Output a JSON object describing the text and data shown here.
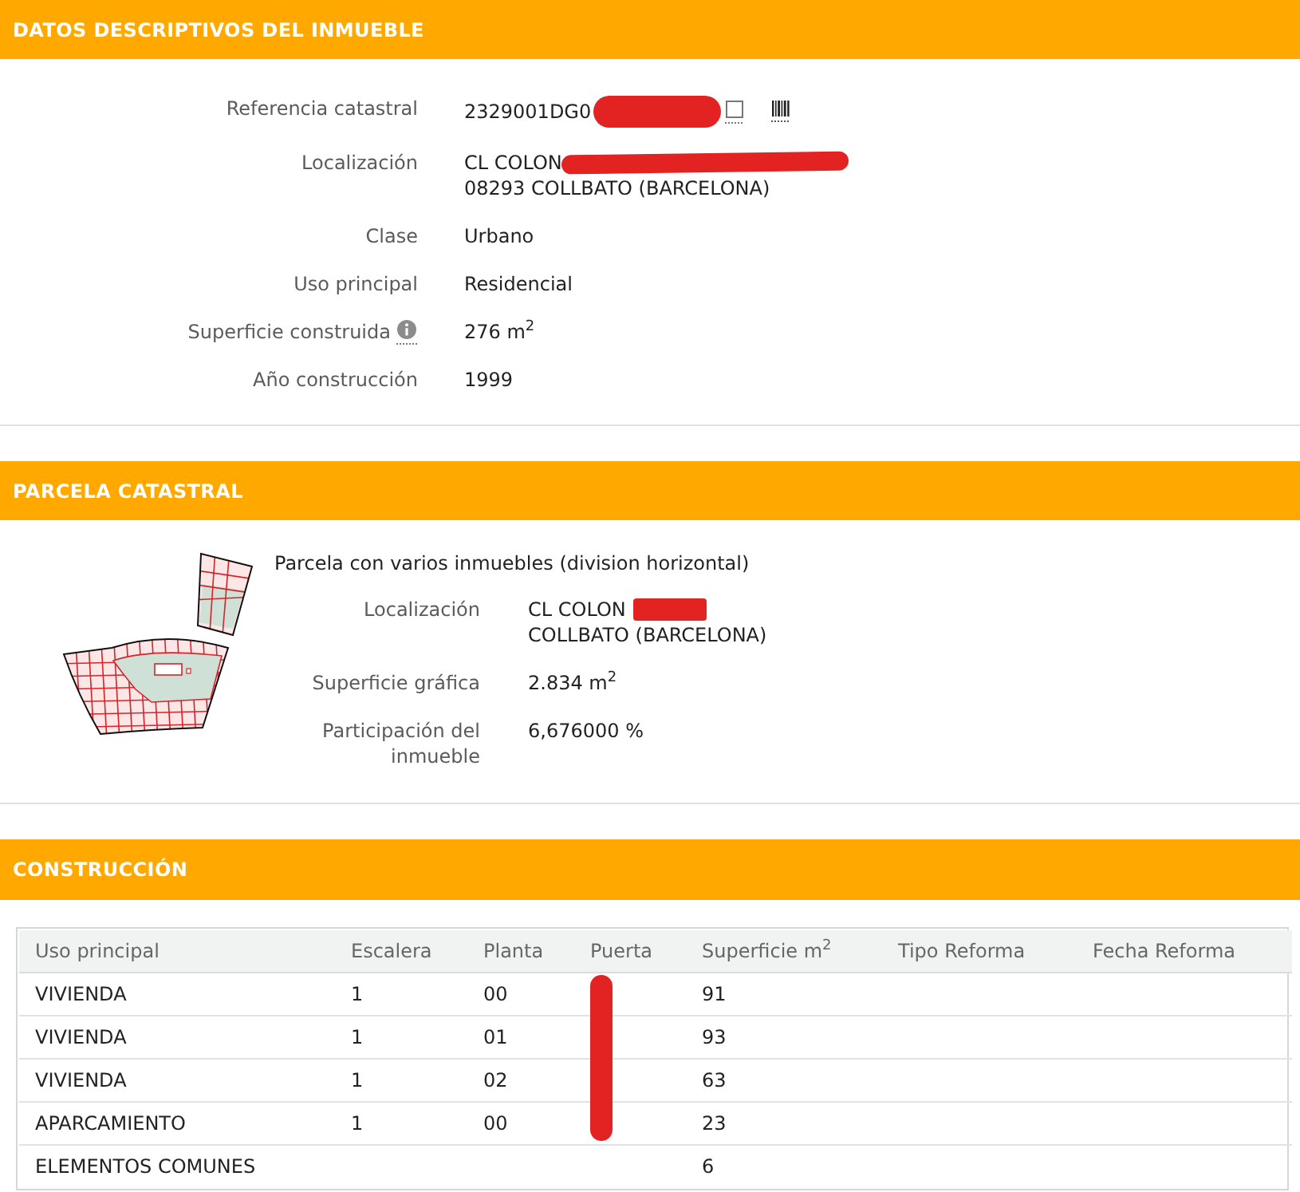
{
  "descriptive_data": {
    "title": "DATOS DESCRIPTIVOS DEL INMUEBLE",
    "fields": [
      {
        "kind": "reference",
        "label": "Referencia catastral",
        "lines": [
          "2329001DG0"
        ],
        "redacted": true
      },
      {
        "kind": "plain",
        "label": "Localización",
        "lines": [
          "CL COLON",
          "08293 COLLBATO (BARCELONA)"
        ],
        "redacted": true
      },
      {
        "kind": "plain",
        "label": "Clase",
        "lines": [
          "Urbano"
        ],
        "redacted": false
      },
      {
        "kind": "plain",
        "label": "Uso principal",
        "lines": [
          "Residencial"
        ],
        "redacted": false
      },
      {
        "kind": "info",
        "label": "Superficie construida",
        "lines": [
          "276 m$^{2}$"
        ],
        "redacted": false
      },
      {
        "kind": "plain",
        "label": "Año construcción",
        "lines": [
          "1999"
        ],
        "redacted": false
      }
    ]
  },
  "cadastral_parcel": {
    "title": "PARCELA CATASTRAL",
    "description": "Parcela con varios inmuebles (division horizontal)",
    "fields": [
      {
        "label": "Localización",
        "lines": [
          "CL COLON",
          "COLLBATO (BARCELONA)"
        ],
        "redacted": true
      },
      {
        "label": "Superficie gráfica",
        "lines": [
          "2.834 m$^{2}$"
        ],
        "redacted": false
      },
      {
        "label": "Participación del inmueble",
        "lines": [
          "6,676000 %"
        ],
        "redacted": false
      }
    ]
  },
  "construction": {
    "title": "CONSTRUCCIÓN",
    "table": {
      "columns": [
        "Uso principal",
        "Escalera",
        "Planta",
        "Puerta",
        "Superficie m$^{2}$",
        "Tipo Reforma",
        "Fecha Reforma"
      ],
      "rows": [
        {
          "uso_principal": "VIVIENDA",
          "escalera": "1",
          "planta": "00",
          "puerta_redacted": true,
          "superficie": "91"
        },
        {
          "uso_principal": "VIVIENDA",
          "escalera": "1",
          "planta": "01",
          "puerta_redacted": true,
          "superficie": "93"
        },
        {
          "uso_principal": "VIVIENDA",
          "escalera": "1",
          "planta": "02",
          "puerta_redacted": true,
          "superficie": "63"
        },
        {
          "uso_principal": "APARCAMIENTO",
          "escalera": "1",
          "planta": "00",
          "puerta_redacted": true,
          "superficie": "23"
        },
        {
          "uso_principal": "ELEMENTOS COMUNES",
          "puerta_redacted": false,
          "superficie": "6"
        }
      ]
    }
  }
}
